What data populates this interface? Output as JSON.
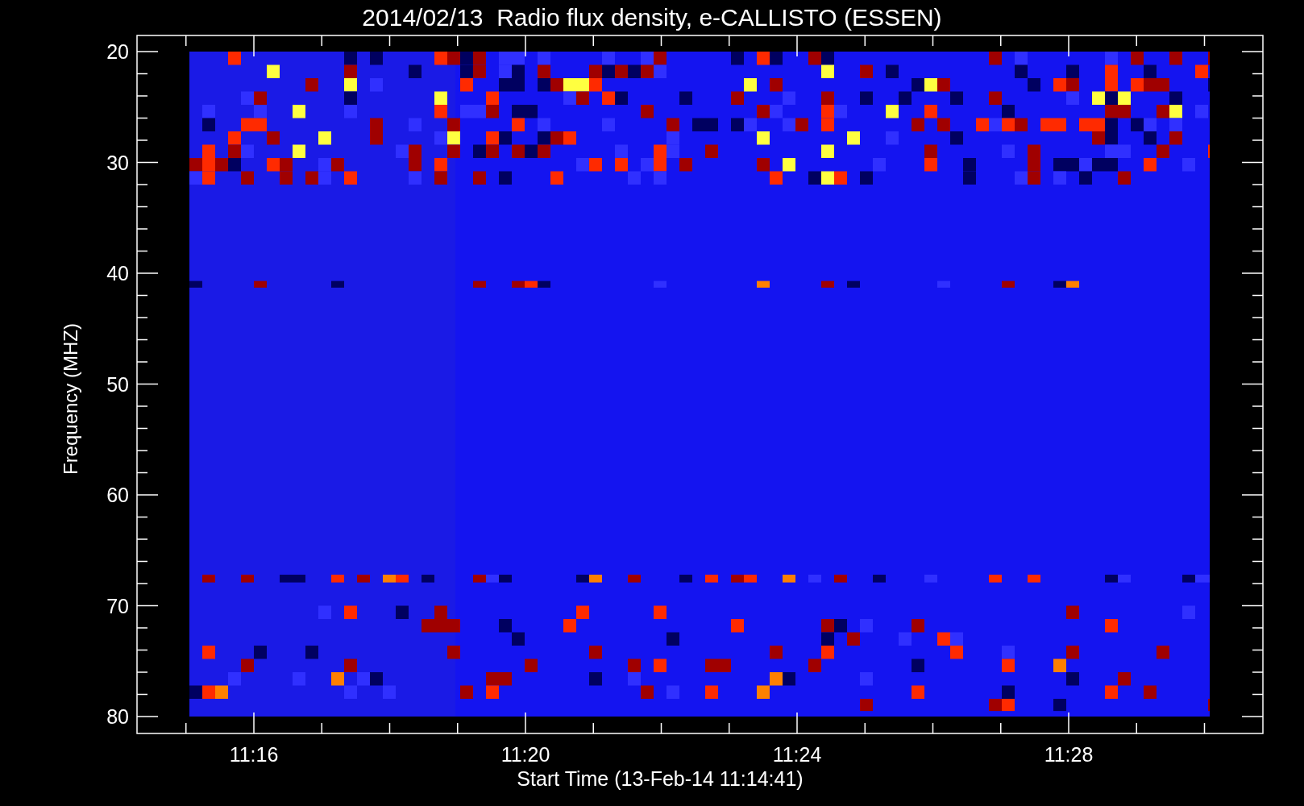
{
  "title": "2014/02/13  Radio flux density, e-CALLISTO (ESSEN)",
  "y_axis": {
    "label": "Frequency (MHZ)",
    "ticks": [
      "20",
      "30",
      "40",
      "50",
      "60",
      "70",
      "80"
    ]
  },
  "x_axis": {
    "label": "Start Time (13-Feb-14 11:14:41)",
    "ticks": [
      "11:16",
      "11:20",
      "11:24",
      "11:28"
    ]
  }
}
